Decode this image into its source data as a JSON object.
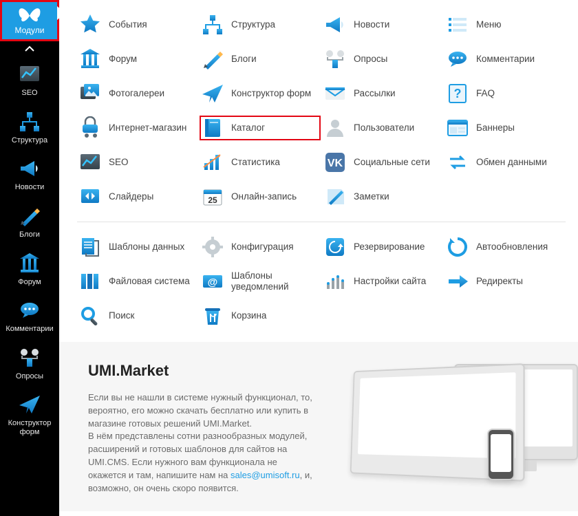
{
  "sidebar": {
    "top_label": "Модули",
    "items": [
      {
        "label": "SEO",
        "icon": "seo"
      },
      {
        "label": "Структура",
        "icon": "structure"
      },
      {
        "label": "Новости",
        "icon": "megaphone"
      },
      {
        "label": "Блоги",
        "icon": "pencils"
      },
      {
        "label": "Форум",
        "icon": "forum"
      },
      {
        "label": "Комментарии",
        "icon": "comments"
      },
      {
        "label": "Опросы",
        "icon": "polls"
      },
      {
        "label": "Конструктор форм",
        "icon": "paperplane"
      }
    ]
  },
  "modules": {
    "group1": [
      {
        "label": "События",
        "icon": "star"
      },
      {
        "label": "Структура",
        "icon": "structure"
      },
      {
        "label": "Новости",
        "icon": "megaphone"
      },
      {
        "label": "Меню",
        "icon": "menu"
      },
      {
        "label": "Форум",
        "icon": "forum"
      },
      {
        "label": "Блоги",
        "icon": "pencils"
      },
      {
        "label": "Опросы",
        "icon": "polls"
      },
      {
        "label": "Комментарии",
        "icon": "comments"
      },
      {
        "label": "Фотогалереи",
        "icon": "gallery"
      },
      {
        "label": "Конструктор форм",
        "icon": "paperplane"
      },
      {
        "label": "Рассылки",
        "icon": "mail"
      },
      {
        "label": "FAQ",
        "icon": "faq"
      },
      {
        "label": "Интернет-магазин",
        "icon": "cart"
      },
      {
        "label": "Каталог",
        "icon": "catalog",
        "highlighted": true
      },
      {
        "label": "Пользователи",
        "icon": "user"
      },
      {
        "label": "Баннеры",
        "icon": "banners"
      },
      {
        "label": "SEO",
        "icon": "seo"
      },
      {
        "label": "Статистика",
        "icon": "stats"
      },
      {
        "label": "Социальные сети",
        "icon": "vk"
      },
      {
        "label": "Обмен данными",
        "icon": "exchange"
      },
      {
        "label": "Слайдеры",
        "icon": "sliders"
      },
      {
        "label": "Онлайн-запись",
        "icon": "calendar"
      },
      {
        "label": "Заметки",
        "icon": "notes"
      }
    ],
    "group2": [
      {
        "label": "Шаблоны данных",
        "icon": "templates"
      },
      {
        "label": "Конфигурация",
        "icon": "config"
      },
      {
        "label": "Резервирование",
        "icon": "backup"
      },
      {
        "label": "Автообновления",
        "icon": "autoupdate"
      },
      {
        "label": "Файловая система",
        "icon": "files"
      },
      {
        "label": "Шаблоны уведомлений",
        "icon": "mailtpl"
      },
      {
        "label": "Настройки сайта",
        "icon": "sitesettings"
      },
      {
        "label": "Редиректы",
        "icon": "redirects"
      },
      {
        "label": "Поиск",
        "icon": "search"
      },
      {
        "label": "Корзина",
        "icon": "trash"
      }
    ]
  },
  "footer": {
    "title": "UMI.Market",
    "p1": "Если вы не нашли в системе нужный функционал, то, вероятно, его можно скачать бесплатно или купить в магазине готовых решений UMI.Market.",
    "p2a": "В нём представлены сотни разнообразных модулей, расширений и готовых шаблонов для сайтов на UMI.CMS. Если нужного вам функционала не окажется и там, напишите нам на ",
    "email": "sales@umisoft.ru",
    "p2b": ", и, возможно, он очень скоро появится."
  }
}
